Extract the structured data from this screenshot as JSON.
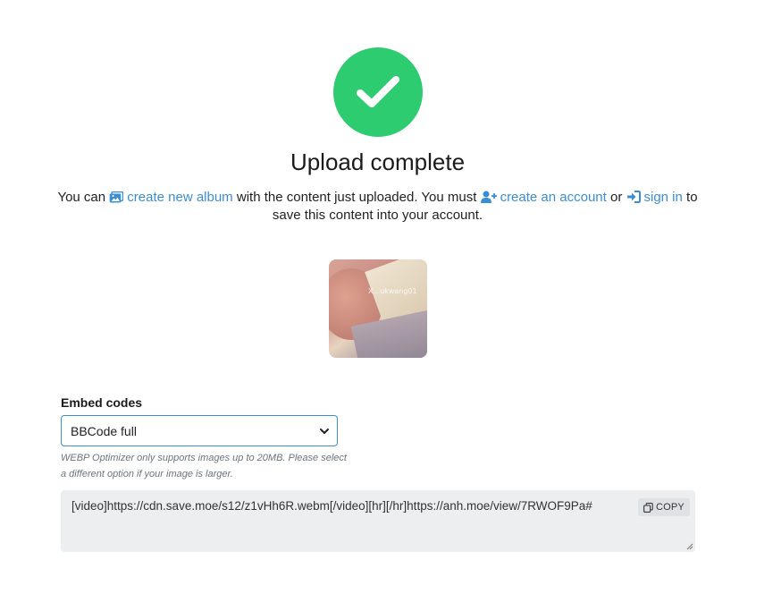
{
  "header": {
    "title": "Upload complete",
    "icon": "check-icon",
    "accent": "#2ecc71"
  },
  "message": {
    "prefix": "You can",
    "album_link": "create new album",
    "middle": "with the content just uploaded. You must",
    "account_link": "create an account",
    "or": "or",
    "signin_link": "sign in",
    "suffix": "to save this content into your account.",
    "link_color": "#3b8ed4"
  },
  "thumbnail": {
    "watermark": "X...ukwang01"
  },
  "embed": {
    "label": "Embed codes",
    "selected": "BBCode full",
    "help": "WEBP Optimizer only supports images up to 20MB. Please select a different option if your image is larger.",
    "code": "[video]https://cdn.save.moe/s12/z1vHh6R.webm[/video][hr][/hr]https://anh.moe/view/7RWOF9Pa#",
    "copy_label": "COPY"
  }
}
